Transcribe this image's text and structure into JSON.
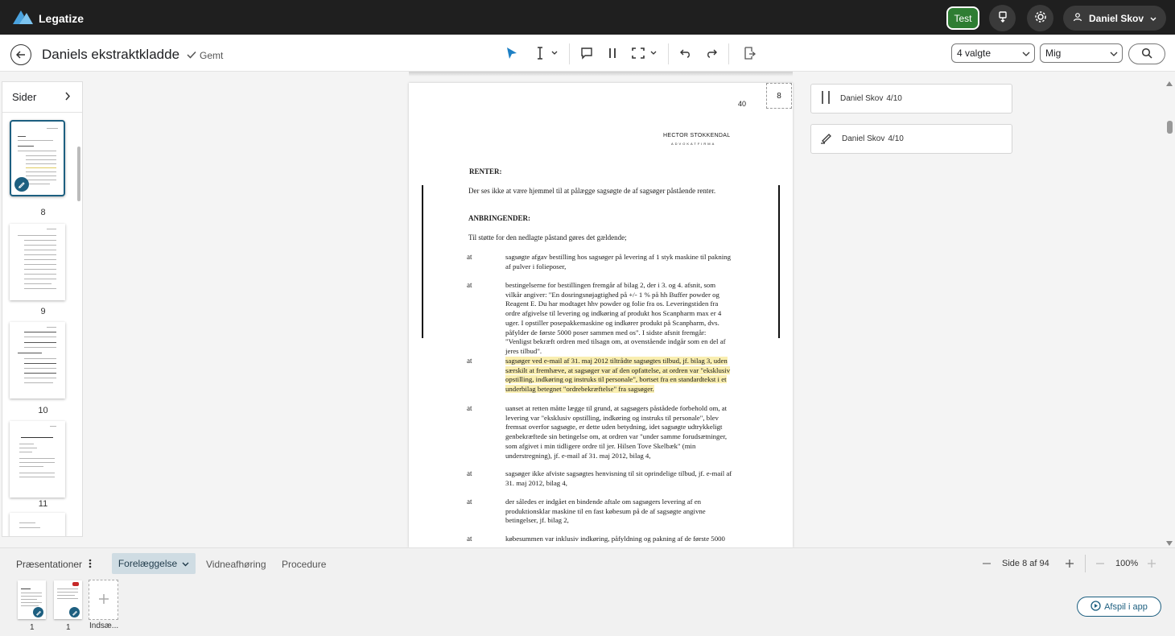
{
  "app": {
    "name": "Legatize",
    "test_label": "Test",
    "user_name": "Daniel Skov"
  },
  "toolbar": {
    "title": "Daniels ekstraktkladde",
    "saved_label": "Gemt",
    "select_filter": "4 valgte",
    "select_user": "Mig"
  },
  "sidebar": {
    "title": "Sider",
    "pages": [
      {
        "label": "8",
        "active": true
      },
      {
        "label": "9",
        "active": false
      },
      {
        "label": "10",
        "active": false
      },
      {
        "label": "11",
        "active": false
      }
    ]
  },
  "document": {
    "page_number": "40",
    "page_box": "8",
    "firm_name": "HECTOR  STOKKENDAL",
    "firm_sub": "ADVOKATFIRMA",
    "h_renter": "RENTER:",
    "renter_text": "Der ses ikke at være hjemmel til at pålægge sagsøgte de af sagsøger påstående renter.",
    "h_anbring": "ANBRINGENDER:",
    "anbring_intro": "Til støtte for den nedlagte påstand gøres det gældende;",
    "at_label": "at",
    "paras": [
      "sagsøgte afgav bestilling hos sagsøger på levering af 1 styk maskine til pakning af pulver i folieposer,",
      "bestingelserne for bestillingen fremgår af bilag 2, der i 3. og 4. afsnit, som vilkår angiver: \"En dosringsnøjagtighed på +/- 1 % på hh Buffer powder og Reagent E. Du har modtaget hhv powder og folie fra os. Leveringstiden fra ordre afgivelse til levering og indkøring af produkt hos Scanpharm max er 4 uger. I opstiller posepakkemaskine og indkører produkt på Scanpharm, dvs. påfylder de første 5000 poser sammen med os\". I sidste afsnit fremgår: \"Venligst bekræft ordren med tilsagn om, at ovenstående indgår som en del af jeres tilbud\".",
      "sagsøger ved e-mail af 31. maj 2012 tiltrådte sagsøgtes tilbud, jf. bilag 3, uden særskilt at fremhæve, at sagsøger var af den opfattelse, at ordren var \"eksklusiv opstilling, indkøring og instruks til personale\", bortset fra en standardtekst i et underbilag betegnet \"ordrebekræftelse\" fra sagsøger.",
      "uanset at retten måtte lægge til grund, at sagsøgers påstådede forbehold om, at levering var \"eksklusiv opstilling, indkøring og instruks til personale\", blev fremsat overfor sagsøgte, er dette uden betydning, idet sagsøgte udtrykkeligt genbekræftede sin betingelse om, at ordren var \"under samme forudsætninger, som afgivet i min tidligere ordre til jer. Hilsen Tove Skelbæk\" (min understregning), jf. e-mail af 31. maj 2012, bilag 4,",
      "sagsøger ikke afviste sagsøgtes henvisning til sit oprindelige tilbud, jf. e-mail af 31. maj 2012, bilag 4,",
      "der således er indgået en bindende aftale om sagsøgers levering af en produktionsklar maskine til en fast købesum på de af sagsøgte angivne betingelser, jf. bilag 2,",
      "købesummen var inklusiv indkøring, påfyldning og pakning af de første 5000"
    ]
  },
  "comments": [
    {
      "author": "Daniel Skov",
      "date": "4/10",
      "icon": "pause-bars-icon"
    },
    {
      "author": "Daniel Skov",
      "date": "4/10",
      "icon": "highlighter-pen-icon"
    }
  ],
  "bottom": {
    "presentations_label": "Præsentationer",
    "tabs": {
      "active": "Forelæggelse",
      "t2": "Vidneafhøring",
      "t3": "Procedure"
    },
    "page_indicator": "Side 8 af 94",
    "zoom": "100%",
    "slides": [
      {
        "label": "1"
      },
      {
        "label": "1"
      }
    ],
    "insert_label": "Indsæ...",
    "play_label": "Afspil i app"
  },
  "colors": {
    "accent": "#1d5f80",
    "test_green": "#2e7d32",
    "highlight": "#f9eeb0",
    "topbar": "#1f1f1f"
  }
}
